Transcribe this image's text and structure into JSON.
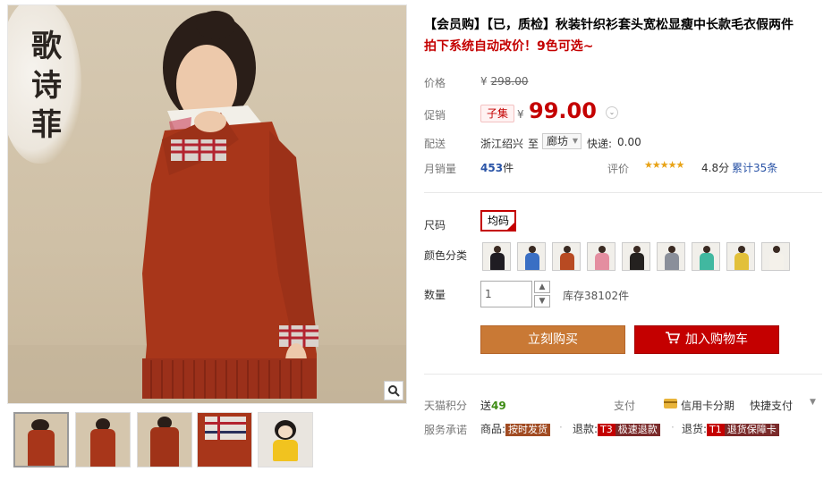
{
  "product": {
    "title": "【会员购】【已，质检】秋装针织衫套头宽松显瘦中长款毛衣假两件",
    "subtitle": "拍下系统自动改价！9色可选~"
  },
  "gallery": {
    "logo_text": "歌诗菲",
    "zoom_icon": "magnifier-icon",
    "thumbnails": [
      "thumb-1",
      "thumb-2",
      "thumb-3",
      "thumb-4",
      "thumb-5"
    ]
  },
  "pricing": {
    "price_label": "价格",
    "currency": "¥",
    "original_price": "298.00",
    "promo_label": "促销",
    "promo_tag": "子集",
    "promo_price": "99.00"
  },
  "shipping": {
    "label": "配送",
    "from": "浙江绍兴",
    "to_word": "至",
    "destination": "廊坊",
    "fee_label": "快递:",
    "fee": "0.00"
  },
  "sales": {
    "label": "月销量",
    "count": "453",
    "unit": "件",
    "rating_label": "评价",
    "stars": "★★★★★",
    "rating": "4.8分",
    "reviews": "累计35条"
  },
  "options": {
    "size_label": "尺码",
    "size_value": "均码",
    "color_label": "颜色分类",
    "colors": [
      "#1f1c22",
      "#3a6fc4",
      "#b84a22",
      "#e48ea0",
      "#24211f",
      "#8a8f9a",
      "#41b8a0",
      "#e2c03a",
      "#f4f1ea"
    ],
    "qty_label": "数量",
    "qty_value": "1",
    "stock": "库存38102件"
  },
  "actions": {
    "buy_now": "立刻购买",
    "add_to_cart": "加入购物车"
  },
  "points": {
    "label": "天猫积分",
    "send": "送",
    "value": "49",
    "pay_label": "支付",
    "card_pay": "信用卡分期",
    "quick_pay": "快捷支付"
  },
  "service": {
    "label": "服务承诺",
    "goods_label": "商品:",
    "goods_badge": "按时发货",
    "refund_label": "退款:",
    "refund_tag": "T3",
    "refund_text": "极速退款",
    "return_label": "退货:",
    "return_tag": "T1",
    "return_text": "退货保障卡"
  }
}
